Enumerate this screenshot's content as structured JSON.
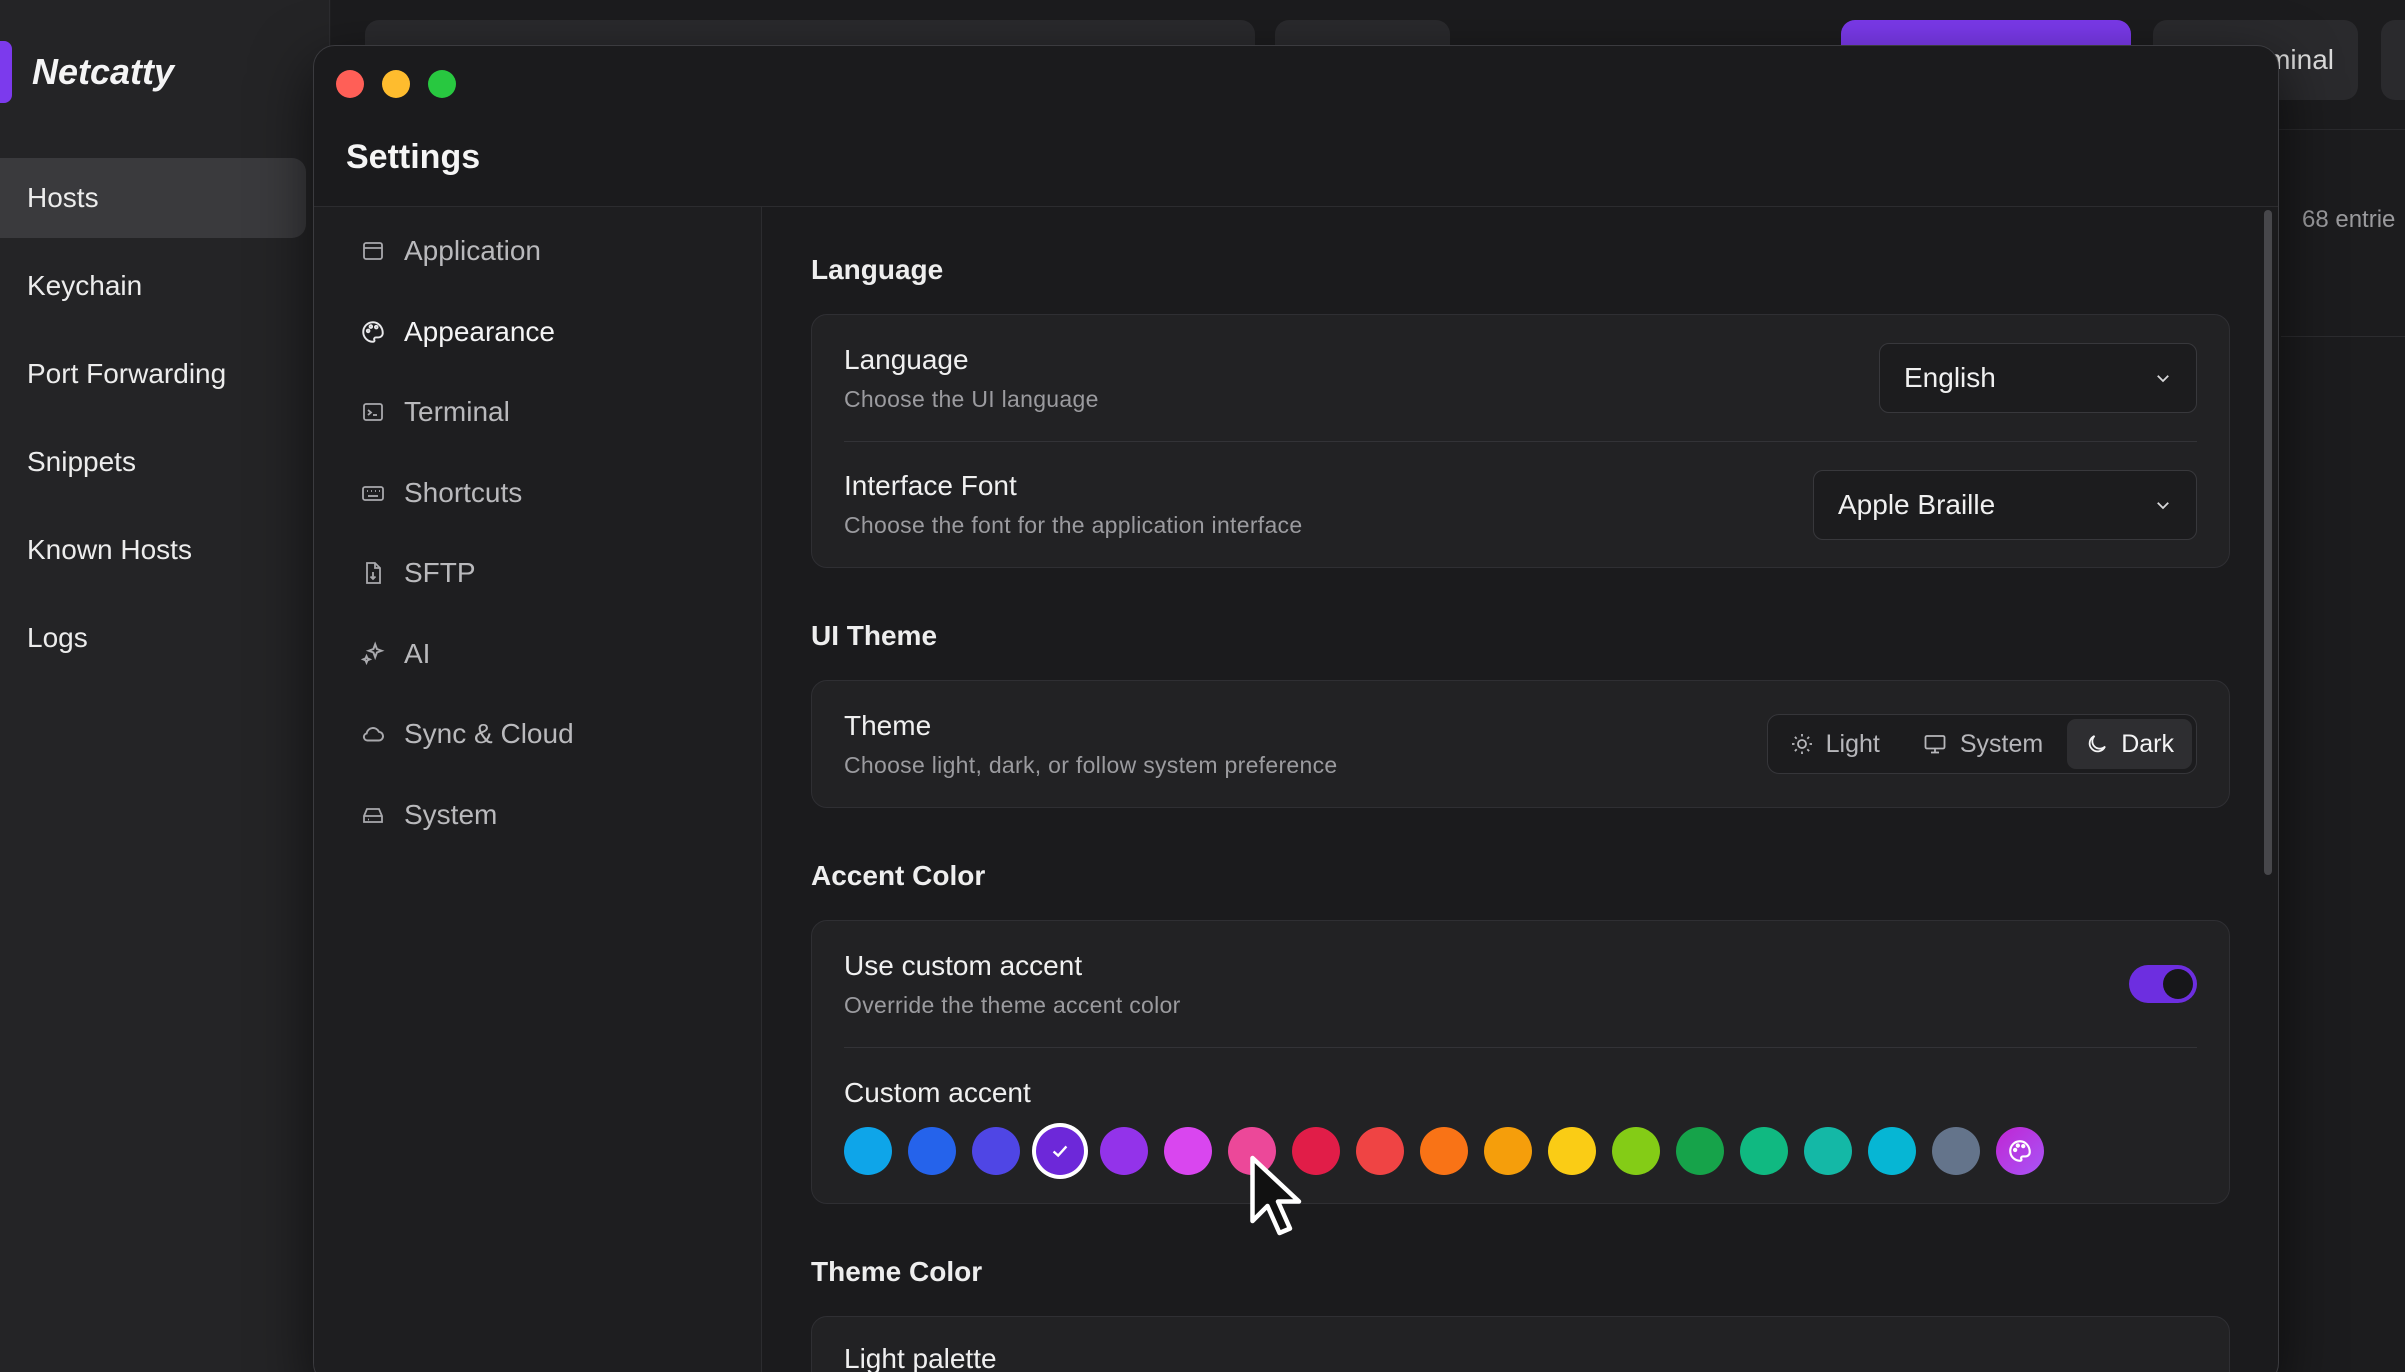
{
  "app": {
    "name": "Netcatty",
    "brand_color": "#7c3aed",
    "nav": [
      {
        "label": "Hosts",
        "active": true
      },
      {
        "label": "Keychain"
      },
      {
        "label": "Port Forwarding"
      },
      {
        "label": "Snippets"
      },
      {
        "label": "Known Hosts"
      },
      {
        "label": "Logs"
      }
    ],
    "top_terminal_label": "minal",
    "entries_label": "68 entrie"
  },
  "window": {
    "title": "Settings",
    "nav": [
      {
        "label": "Application",
        "icon": "window-icon"
      },
      {
        "label": "Appearance",
        "icon": "palette-icon",
        "active": true
      },
      {
        "label": "Terminal",
        "icon": "terminal-icon"
      },
      {
        "label": "Shortcuts",
        "icon": "keyboard-icon"
      },
      {
        "label": "SFTP",
        "icon": "file-icon"
      },
      {
        "label": "AI",
        "icon": "sparkles-icon"
      },
      {
        "label": "Sync & Cloud",
        "icon": "cloud-icon"
      },
      {
        "label": "System",
        "icon": "drive-icon"
      }
    ]
  },
  "sections": {
    "language": {
      "title": "Language",
      "language_label": "Language",
      "language_desc": "Choose the UI language",
      "language_value": "English",
      "font_label": "Interface Font",
      "font_desc": "Choose the font for the application interface",
      "font_value": "Apple Braille"
    },
    "ui_theme": {
      "title": "UI Theme",
      "theme_label": "Theme",
      "theme_desc": "Choose light, dark, or follow system preference",
      "options": [
        "Light",
        "System",
        "Dark"
      ],
      "selected": "Dark"
    },
    "accent": {
      "title": "Accent Color",
      "use_label": "Use custom accent",
      "use_desc": "Override the theme accent color",
      "use_enabled": true,
      "custom_label": "Custom accent",
      "swatches": [
        "#0ea5e9",
        "#2563eb",
        "#4f46e5",
        "#6d28d9",
        "#9333ea",
        "#d946ef",
        "#ec4899",
        "#e11d48",
        "#ef4444",
        "#f97316",
        "#f59e0b",
        "#facc15",
        "#84cc16",
        "#16a34a",
        "#10b981",
        "#14b8a6",
        "#06b6d4",
        "#64748b",
        "custom"
      ],
      "selected_index": 3,
      "custom_swatch_color": "#a855f7"
    },
    "theme_color": {
      "title": "Theme Color",
      "light_palette_label": "Light palette"
    }
  }
}
